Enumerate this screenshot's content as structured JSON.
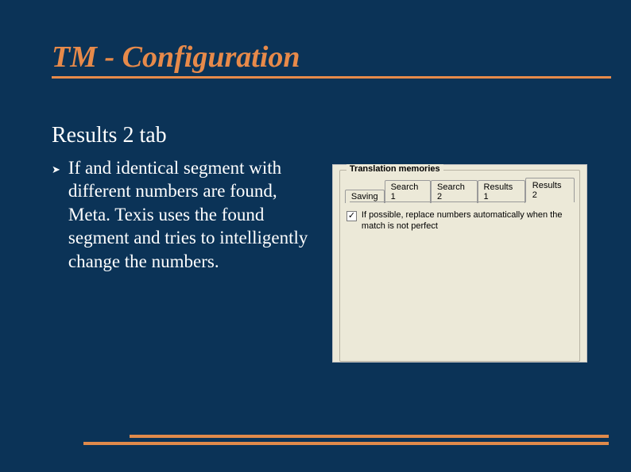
{
  "title": "TM - Configuration",
  "subhead": "Results 2 tab",
  "bullet": "If and identical segment with different numbers are found, Meta. Texis uses the found segment and tries to intelligently change the numbers.",
  "panel": {
    "legend": "Translation memories",
    "tabs": {
      "saving": "Saving",
      "search1": "Search 1",
      "search2": "Search 2",
      "results1": "Results 1",
      "results2": "Results 2"
    },
    "checkbox_label": "If possible, replace numbers automatically when the match is not perfect"
  }
}
